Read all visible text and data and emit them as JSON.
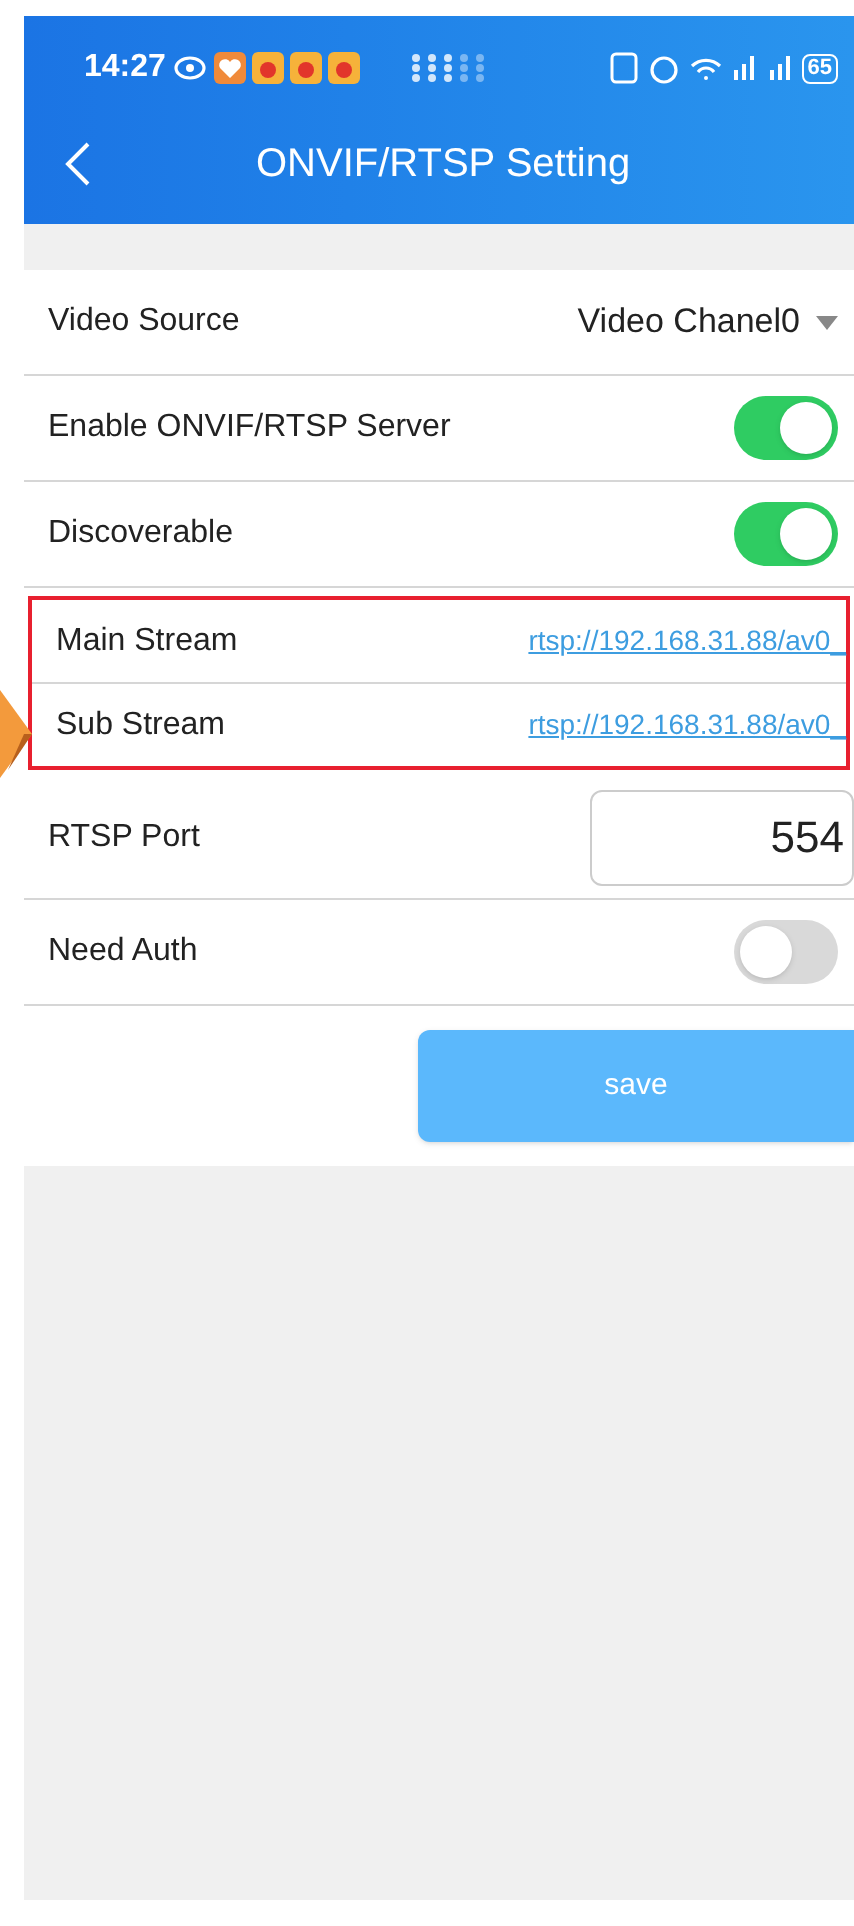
{
  "status_bar": {
    "time": "14:27",
    "battery": "65"
  },
  "header": {
    "title": "ONVIF/RTSP Setting"
  },
  "settings": [
    {
      "kind": "dropdown",
      "label": "Video Source",
      "value": "Video Chanel0"
    },
    {
      "kind": "toggle",
      "label": "Enable ONVIF/RTSP Server",
      "on": true
    },
    {
      "kind": "toggle",
      "label": "Discoverable",
      "on": true
    },
    {
      "kind": "link",
      "label": "Main Stream",
      "value": "rtsp://192.168.31.88/av0_",
      "highlighted": true
    },
    {
      "kind": "link",
      "label": "Sub Stream",
      "value": "rtsp://192.168.31.88/av0_",
      "highlighted": true
    },
    {
      "kind": "input",
      "label": "RTSP Port",
      "value": "554"
    },
    {
      "kind": "toggle",
      "label": "Need Auth",
      "on": false
    }
  ],
  "save_button": {
    "label": "save"
  }
}
